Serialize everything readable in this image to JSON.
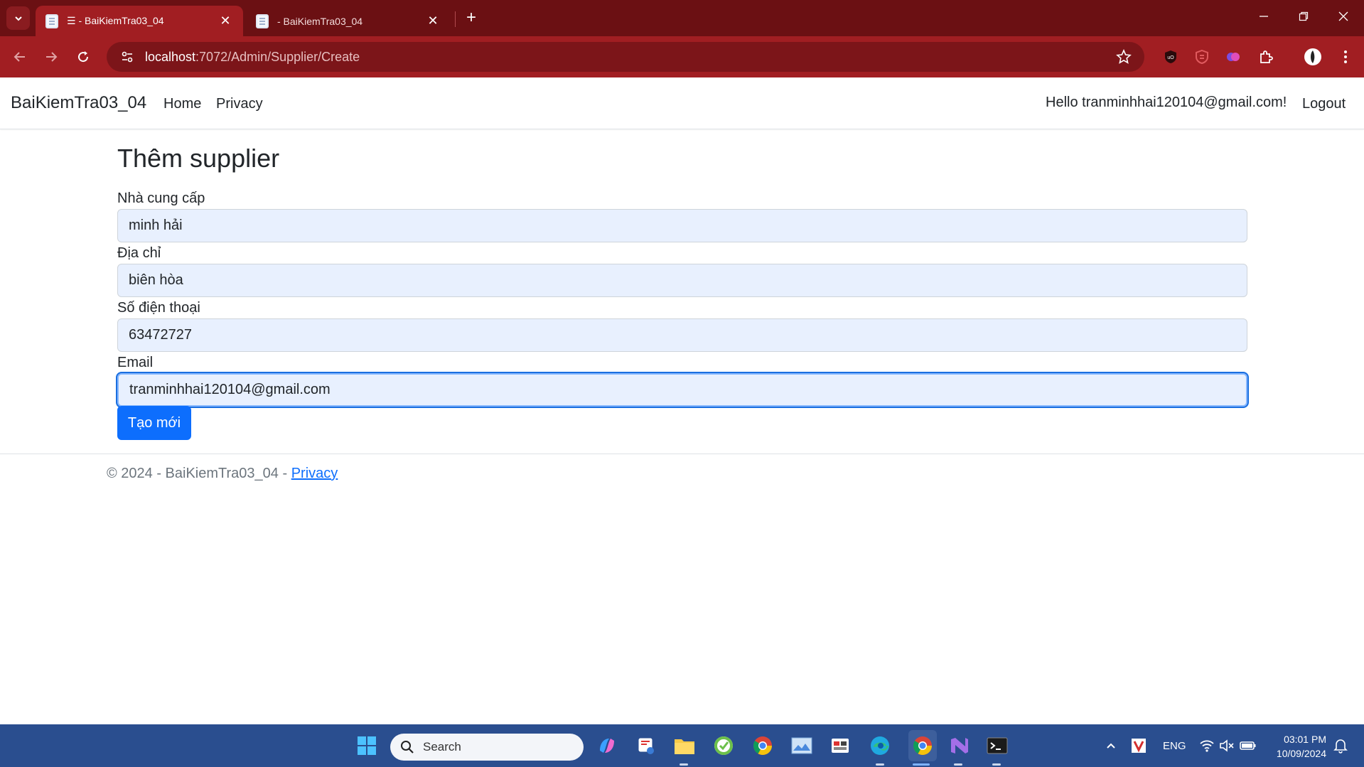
{
  "browser": {
    "tabs": [
      {
        "title": "☰ - BaiKiemTra03_04",
        "active": true
      },
      {
        "title": "- BaiKiemTra03_04",
        "active": false
      }
    ],
    "url_host": "localhost",
    "url_path": ":7072/Admin/Supplier/Create",
    "window_controls": [
      "minimize-icon",
      "restore-icon",
      "close-icon"
    ]
  },
  "app_nav": {
    "brand": "BaiKiemTra03_04",
    "links": [
      "Home",
      "Privacy"
    ],
    "greeting": "Hello tranminhhai120104@gmail.com!",
    "logout": "Logout"
  },
  "form": {
    "title": "Thêm supplier",
    "fields": [
      {
        "label": "Nhà cung cấp",
        "value": "minh hải"
      },
      {
        "label": "Địa chỉ",
        "value": "biên hòa"
      },
      {
        "label": "Số điện thoại",
        "value": "63472727"
      },
      {
        "label": "Email",
        "value": "tranminhhai120104@gmail.com"
      }
    ],
    "submit_label": "Tạo mới"
  },
  "footer": {
    "text": "© 2024 - BaiKiemTra03_04 - ",
    "link": "Privacy"
  },
  "taskbar": {
    "search_placeholder": "Search",
    "language": "ENG",
    "time": "03:01 PM",
    "date": "10/09/2024"
  },
  "colors": {
    "tabstrip": "#6b1013",
    "toolbar": "#a11e22",
    "primary_button": "#0d6efd",
    "input_autofill_bg": "#e8f0fe",
    "taskbar": "#2a4e8f"
  }
}
